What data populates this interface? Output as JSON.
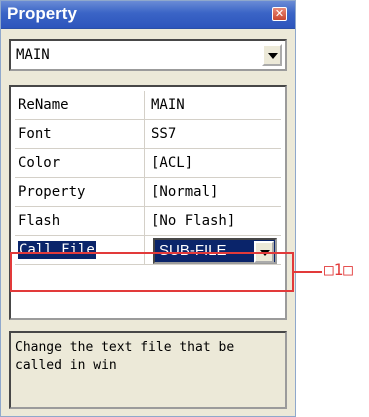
{
  "window": {
    "title": "Property",
    "close_glyph": "✕"
  },
  "object_selector": {
    "value": "MAIN"
  },
  "properties": [
    {
      "name": "ReName",
      "value": "MAIN"
    },
    {
      "name": "Font",
      "value": "SS7"
    },
    {
      "name": "Color",
      "value": "[ACL]"
    },
    {
      "name": "Property",
      "value": "[Normal]"
    },
    {
      "name": "Flash",
      "value": "[No Flash]"
    },
    {
      "name": "Call File",
      "value": "SUB-FILE",
      "selected": true
    }
  ],
  "description": "Change the text file that be called in win",
  "callout": {
    "label": "□1□"
  }
}
